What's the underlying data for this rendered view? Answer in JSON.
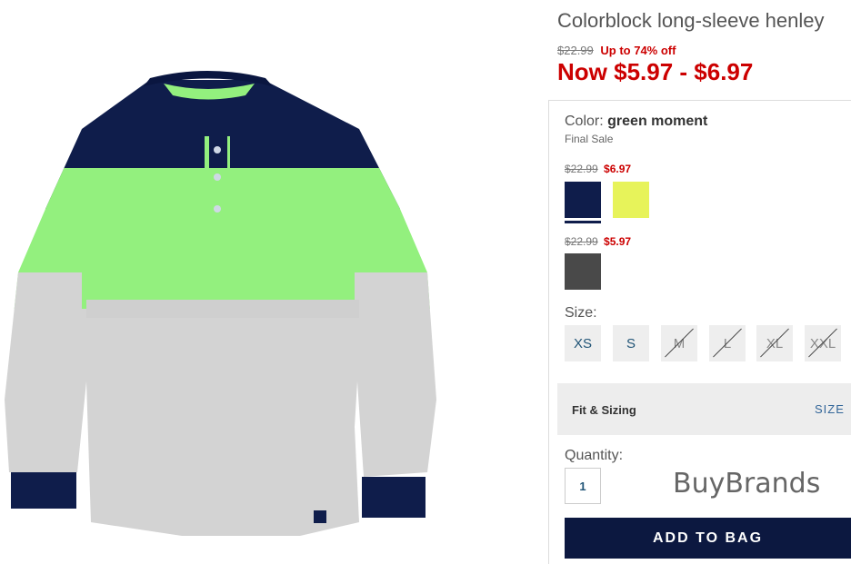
{
  "product": {
    "title": "Colorblock long-sleeve henley",
    "original_price": "$22.99",
    "discount": "Up to 74% off",
    "now_price": "Now $5.97 - $6.97"
  },
  "color": {
    "label": "Color:",
    "value": "green moment",
    "final_sale": "Final Sale",
    "groups": [
      {
        "original": "$22.99",
        "sale": "$6.97",
        "swatches": [
          "#0f1d4b",
          "#e7f35a"
        ]
      },
      {
        "original": "$22.99",
        "sale": "$5.97",
        "swatches": [
          "#494949"
        ]
      }
    ]
  },
  "size": {
    "label": "Size:",
    "options": [
      {
        "label": "XS",
        "available": true
      },
      {
        "label": "S",
        "available": true
      },
      {
        "label": "M",
        "available": false
      },
      {
        "label": "L",
        "available": false
      },
      {
        "label": "XL",
        "available": false
      },
      {
        "label": "XXL",
        "available": false
      }
    ]
  },
  "fit": {
    "label": "Fit & Sizing",
    "link": "SIZE"
  },
  "quantity": {
    "label": "Quantity:",
    "value": "1"
  },
  "watermark": "BuyBrands",
  "add_button": "ADD TO BAG",
  "colors": {
    "sale_red": "#cc0000",
    "navy": "#0c1840"
  },
  "image": {
    "shirt_colors": [
      "#0f1d4b",
      "#93f07e",
      "#d3d3d3"
    ]
  }
}
